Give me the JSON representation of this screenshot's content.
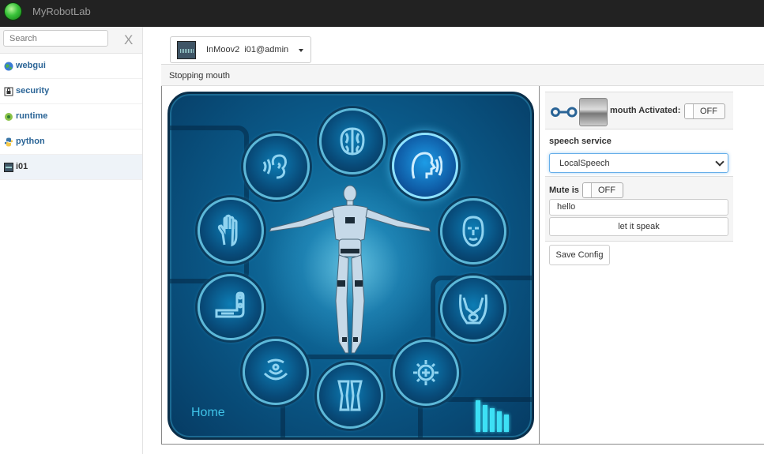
{
  "app": {
    "title": "MyRobotLab"
  },
  "sidebar": {
    "search_placeholder": "Search",
    "clear_label": "X",
    "items": [
      {
        "label": "webgui",
        "icon": "globe-icon"
      },
      {
        "label": "security",
        "icon": "lock-icon"
      },
      {
        "label": "runtime",
        "icon": "runtime-icon"
      },
      {
        "label": "python",
        "icon": "python-icon"
      },
      {
        "label": "i01",
        "icon": "inmoov-icon",
        "active": true
      }
    ]
  },
  "service_selector": {
    "name": "InMoov2",
    "id": "i01@admin"
  },
  "status": {
    "message": "Stopping mouth"
  },
  "inmoov_panel": {
    "home_label": "Home",
    "buttons": [
      "brain",
      "ear",
      "speech",
      "hand",
      "head",
      "arm",
      "neck",
      "torso",
      "leg",
      "settings"
    ],
    "active_button": "speech"
  },
  "mouth": {
    "activated_label": "mouth Activated:",
    "activated_state": "OFF",
    "speech_service_label": "speech service",
    "speech_service_value": "LocalSpeech",
    "mute_label": "Mute is",
    "mute_state": "OFF",
    "speak_text": "hello",
    "speak_button": "let it speak",
    "save_button": "Save Config"
  },
  "colors": {
    "topbar": "#222222",
    "panel_blue": "#0b5c8c",
    "glow": "#3de0f5",
    "link": "#2a6496"
  }
}
